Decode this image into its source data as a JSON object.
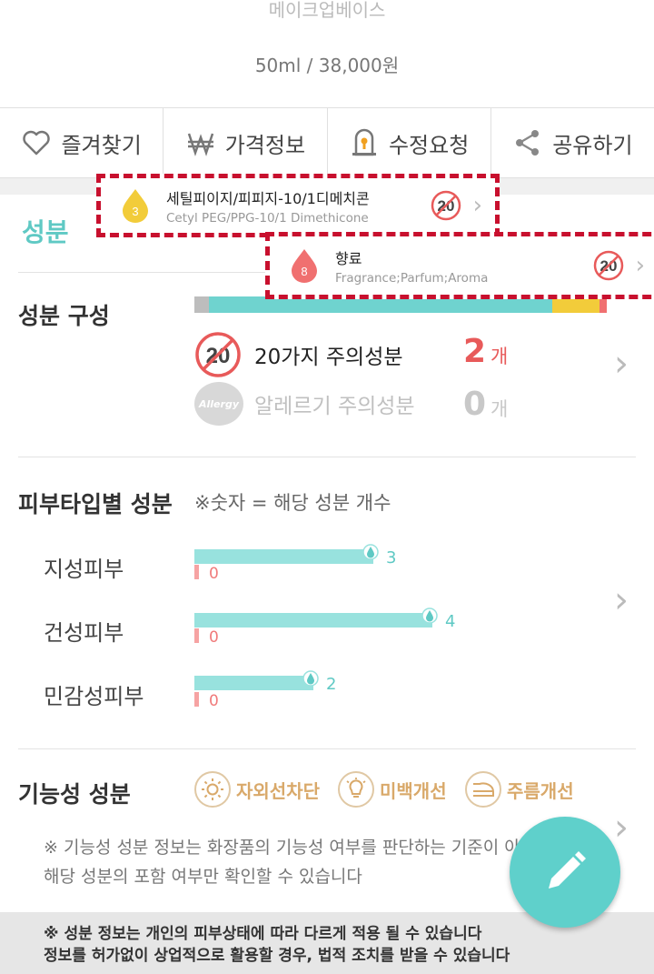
{
  "product": {
    "name": "메이크업베이스",
    "price": "50ml / 38,000원"
  },
  "actions": [
    {
      "label": "즐겨찾기",
      "icon": "heart-icon"
    },
    {
      "label": "가격정보",
      "icon": "won-icon"
    },
    {
      "label": "수정요청",
      "icon": "lock-edit-icon"
    },
    {
      "label": "공유하기",
      "icon": "share-icon"
    }
  ],
  "section_title": "성분",
  "composition": {
    "title": "성분 구성",
    "caution20": {
      "label": "20가지 주의성분",
      "count": "2",
      "unit": "개"
    },
    "allergy": {
      "label": "알레르기 주의성분",
      "count": "0",
      "unit": "개",
      "badge": "Allergy"
    },
    "badge20": "20"
  },
  "skin_type": {
    "title": "피부타입별 성분",
    "note": "※숫자 = 해당 성분 개수",
    "rows": [
      {
        "label": "지성피부",
        "good": "3",
        "bad": "0",
        "good_ratio": 0.75
      },
      {
        "label": "건성피부",
        "good": "4",
        "bad": "0",
        "good_ratio": 1.0
      },
      {
        "label": "민감성피부",
        "good": "2",
        "bad": "0",
        "good_ratio": 0.5
      }
    ]
  },
  "functional": {
    "title": "기능성 성분",
    "badges": [
      {
        "label": "자외선차단",
        "icon": "sun-icon"
      },
      {
        "label": "미백개선",
        "icon": "bulb-icon"
      },
      {
        "label": "주름개선",
        "icon": "iron-icon"
      }
    ],
    "desc_line1": "※ 기능성 성분 정보는 화장품의 기능성 여부를 판단하는 기준이 아",
    "desc_line2": "해당 성분의 포함 여부만 확인할 수 있습니다"
  },
  "footer": {
    "line1": "※ 성분 정보는 개인의 피부상태에 따라 다르게 적용 될 수 있습니다",
    "line2": "정보를 허가없이 상업적으로 활용할 경우, 법적 조치를 받을 수 있습니다"
  },
  "popups": [
    {
      "grade": "3",
      "name": "세틸피이지/피피지-10/1디메치콘",
      "en": "Cetyl PEG/PPG-10/1 Dimethicone",
      "badge": "20",
      "color": "#f2cc3a"
    },
    {
      "grade": "8",
      "name": "향료",
      "en": "Fragrance;Parfum;Aroma",
      "badge": "20",
      "color": "#f07070"
    }
  ],
  "colors": {
    "accent": "#5fc9c4",
    "warn": "#e85a5a",
    "popup_border": "#c8102e"
  }
}
